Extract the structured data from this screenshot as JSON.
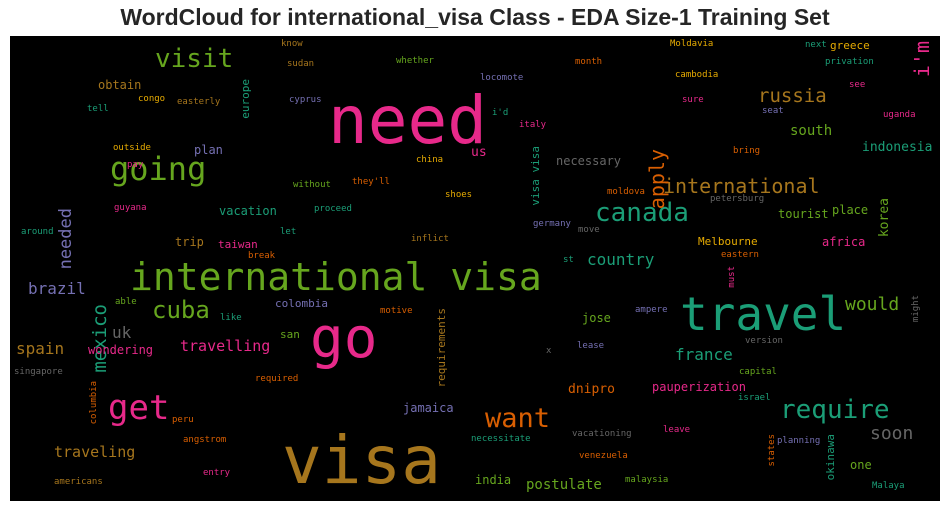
{
  "title": "WordCloud for international_visa Class - EDA Size-1 Training Set",
  "chart_data": {
    "type": "wordcloud",
    "words": [
      {
        "text": "need",
        "color": "#e7298a"
      },
      {
        "text": "visa",
        "color": "#a6761d"
      },
      {
        "text": "international visa",
        "color": "#66a61e"
      },
      {
        "text": "travel",
        "color": "#1b9e77"
      },
      {
        "text": "go",
        "color": "#e7298a"
      },
      {
        "text": "get",
        "color": "#e7298a"
      },
      {
        "text": "going",
        "color": "#66a61e"
      },
      {
        "text": "canada",
        "color": "#1b9e77"
      },
      {
        "text": "require",
        "color": "#1b9e77"
      },
      {
        "text": "want",
        "color": "#d95f02"
      },
      {
        "text": "visit",
        "color": "#66a61e"
      },
      {
        "text": "cuba",
        "color": "#66a61e"
      },
      {
        "text": "international",
        "color": "#a6761d"
      },
      {
        "text": "apply",
        "color": "#d95f02"
      },
      {
        "text": "mexico",
        "color": "#1b9e77"
      },
      {
        "text": "i'm",
        "color": "#e7298a"
      },
      {
        "text": "russia",
        "color": "#a6761d"
      },
      {
        "text": "would",
        "color": "#66a61e"
      },
      {
        "text": "needed",
        "color": "#7570b3"
      },
      {
        "text": "soon",
        "color": "#666666"
      },
      {
        "text": "country",
        "color": "#1b9e77"
      },
      {
        "text": "brazil",
        "color": "#7570b3"
      },
      {
        "text": "france",
        "color": "#1b9e77"
      },
      {
        "text": "spain",
        "color": "#a6761d"
      },
      {
        "text": "travelling",
        "color": "#e7298a"
      },
      {
        "text": "traveling",
        "color": "#a6761d"
      },
      {
        "text": "south",
        "color": "#66a61e"
      },
      {
        "text": "korea",
        "color": "#66a61e"
      },
      {
        "text": "uk",
        "color": "#666666"
      },
      {
        "text": "indonesia",
        "color": "#1b9e77"
      },
      {
        "text": "postulate",
        "color": "#66a61e"
      },
      {
        "text": "obtain",
        "color": "#a6761d"
      },
      {
        "text": "place",
        "color": "#66a61e"
      },
      {
        "text": "tourist",
        "color": "#66a61e"
      },
      {
        "text": "trip",
        "color": "#a6761d"
      },
      {
        "text": "africa",
        "color": "#e7298a"
      },
      {
        "text": "Melbourne",
        "color": "#e6ab02"
      },
      {
        "text": "dnipro",
        "color": "#d95f02"
      },
      {
        "text": "jose",
        "color": "#66a61e"
      },
      {
        "text": "pauperization",
        "color": "#e7298a"
      },
      {
        "text": "jamaica",
        "color": "#7570b3"
      },
      {
        "text": "india",
        "color": "#66a61e"
      },
      {
        "text": "one",
        "color": "#66a61e"
      },
      {
        "text": "necessary",
        "color": "#666666"
      },
      {
        "text": "vacation",
        "color": "#1b9e77"
      },
      {
        "text": "plan",
        "color": "#7570b3"
      },
      {
        "text": "us",
        "color": "#e7298a"
      },
      {
        "text": "wondering",
        "color": "#e7298a"
      },
      {
        "text": "europe",
        "color": "#1b9e77"
      },
      {
        "text": "taiwan",
        "color": "#e7298a"
      },
      {
        "text": "colombia",
        "color": "#7570b3"
      },
      {
        "text": "san",
        "color": "#66a61e"
      },
      {
        "text": "requirements",
        "color": "#a6761d"
      },
      {
        "text": "visa visa",
        "color": "#1b9e77"
      },
      {
        "text": "okinawa",
        "color": "#1b9e77"
      },
      {
        "text": "greece",
        "color": "#e6ab02"
      },
      {
        "text": "know",
        "color": "#a6761d"
      },
      {
        "text": "whether",
        "color": "#66a61e"
      },
      {
        "text": "Moldavia",
        "color": "#e6ab02"
      },
      {
        "text": "next",
        "color": "#1b9e77"
      },
      {
        "text": "sudan",
        "color": "#a6761d"
      },
      {
        "text": "month",
        "color": "#d95f02"
      },
      {
        "text": "privation",
        "color": "#1b9e77"
      },
      {
        "text": "locomote",
        "color": "#7570b3"
      },
      {
        "text": "cambodia",
        "color": "#e6ab02"
      },
      {
        "text": "congo",
        "color": "#e6ab02"
      },
      {
        "text": "cyprus",
        "color": "#7570b3"
      },
      {
        "text": "i'd",
        "color": "#1b9e77"
      },
      {
        "text": "sure",
        "color": "#e7298a"
      },
      {
        "text": "see",
        "color": "#e7298a"
      },
      {
        "text": "tell",
        "color": "#1b9e77"
      },
      {
        "text": "easterly",
        "color": "#a6761d"
      },
      {
        "text": "seat",
        "color": "#7570b3"
      },
      {
        "text": "uganda",
        "color": "#e7298a"
      },
      {
        "text": "italy",
        "color": "#e7298a"
      },
      {
        "text": "outside",
        "color": "#e6ab02"
      },
      {
        "text": "bring",
        "color": "#d95f02"
      },
      {
        "text": "china",
        "color": "#e6ab02"
      },
      {
        "text": "pay",
        "color": "#e7298a"
      },
      {
        "text": "without",
        "color": "#66a61e"
      },
      {
        "text": "they'll",
        "color": "#d95f02"
      },
      {
        "text": "moldova",
        "color": "#d95f02"
      },
      {
        "text": "guyana",
        "color": "#e7298a"
      },
      {
        "text": "shoes",
        "color": "#e6ab02"
      },
      {
        "text": "petersburg",
        "color": "#666666"
      },
      {
        "text": "proceed",
        "color": "#1b9e77"
      },
      {
        "text": "germany",
        "color": "#7570b3"
      },
      {
        "text": "around",
        "color": "#1b9e77"
      },
      {
        "text": "let",
        "color": "#1b9e77"
      },
      {
        "text": "inflict",
        "color": "#a6761d"
      },
      {
        "text": "move",
        "color": "#666666"
      },
      {
        "text": "break",
        "color": "#d95f02"
      },
      {
        "text": "st",
        "color": "#1b9e77"
      },
      {
        "text": "eastern",
        "color": "#d95f02"
      },
      {
        "text": "must",
        "color": "#e7298a"
      },
      {
        "text": "able",
        "color": "#66a61e"
      },
      {
        "text": "like",
        "color": "#1b9e77"
      },
      {
        "text": "motive",
        "color": "#d95f02"
      },
      {
        "text": "ampere",
        "color": "#7570b3"
      },
      {
        "text": "might",
        "color": "#666666"
      },
      {
        "text": "version",
        "color": "#666666"
      },
      {
        "text": "lease",
        "color": "#7570b3"
      },
      {
        "text": "x",
        "color": "#666666"
      },
      {
        "text": "singapore",
        "color": "#666666"
      },
      {
        "text": "required",
        "color": "#d95f02"
      },
      {
        "text": "capital",
        "color": "#66a61e"
      },
      {
        "text": "columbia",
        "color": "#d95f02"
      },
      {
        "text": "israel",
        "color": "#1b9e77"
      },
      {
        "text": "peru",
        "color": "#d95f02"
      },
      {
        "text": "angstrom",
        "color": "#d95f02"
      },
      {
        "text": "vacationing",
        "color": "#666666"
      },
      {
        "text": "necessitate",
        "color": "#1b9e77"
      },
      {
        "text": "leave",
        "color": "#e7298a"
      },
      {
        "text": "states",
        "color": "#d95f02"
      },
      {
        "text": "planning",
        "color": "#7570b3"
      },
      {
        "text": "venezuela",
        "color": "#d95f02"
      },
      {
        "text": "entry",
        "color": "#e7298a"
      },
      {
        "text": "americans",
        "color": "#a6761d"
      },
      {
        "text": "malaysia",
        "color": "#66a61e"
      },
      {
        "text": "Malaya",
        "color": "#1b9e77"
      }
    ]
  }
}
